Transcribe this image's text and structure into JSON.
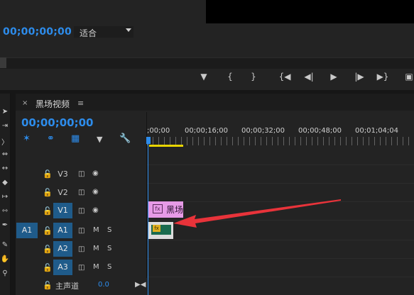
{
  "program_monitor": {
    "timecode": "00;00;00;00",
    "zoom": "适合",
    "transport": [
      "marker-add-icon",
      "mark-in-icon",
      "mark-out-icon",
      "go-to-in-icon",
      "step-back-icon",
      "play-icon",
      "step-forward-icon",
      "go-to-out-icon",
      "insert-icon"
    ]
  },
  "timeline": {
    "tab_close": "×",
    "tab_title": "黑场视频",
    "tab_menu": "≡",
    "timecode": "00;00;00;00",
    "ruler_labels": [
      ";00;00",
      "00;00;16;00",
      "00;00;32;00",
      "00;00;48;00",
      "00;01;04;04"
    ],
    "tracks": {
      "v3": "V3",
      "v2": "V2",
      "v1": "V1",
      "a1_src": "A1",
      "a1": "A1",
      "a2": "A2",
      "a3": "A3",
      "mute": "M",
      "solo": "S"
    },
    "master": {
      "label": "主声道",
      "value": "0.0"
    },
    "clips": {
      "v1_label": "黑场",
      "fx": "fx"
    }
  },
  "colors": {
    "accent": "#2d8ceb",
    "video_clip": "#e69ae6",
    "audio_clip": "#1a6b4e",
    "arrow": "#e8333a"
  }
}
